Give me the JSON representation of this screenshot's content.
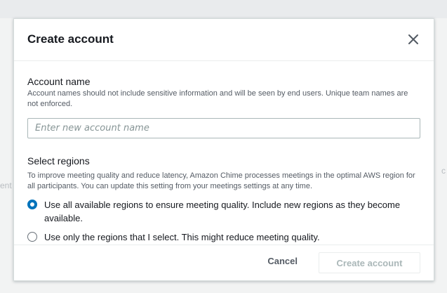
{
  "background": {
    "faint_right_top": "",
    "faint_left": "ent",
    "faint_right_mid": "c"
  },
  "modal": {
    "title": "Create account",
    "close_icon": "close-icon",
    "account_name": {
      "label": "Account name",
      "description": "Account names should not include sensitive information and will be seen by end users. Unique team names are not enforced.",
      "placeholder": "Enter new account name",
      "value": ""
    },
    "regions": {
      "label": "Select regions",
      "description": "To improve meeting quality and reduce latency, Amazon Chime processes meetings in the optimal AWS region for all participants. You can update this setting from your meetings settings at any time.",
      "options": [
        {
          "label": "Use all available regions to ensure meeting quality. Include new regions as they become available.",
          "selected": true
        },
        {
          "label": "Use only the regions that I select. This might reduce meeting quality.",
          "selected": false
        }
      ]
    },
    "footer": {
      "cancel_label": "Cancel",
      "create_label": "Create account"
    }
  },
  "colors": {
    "accent": "#0073bb",
    "disabled_text": "#aab7b8"
  }
}
